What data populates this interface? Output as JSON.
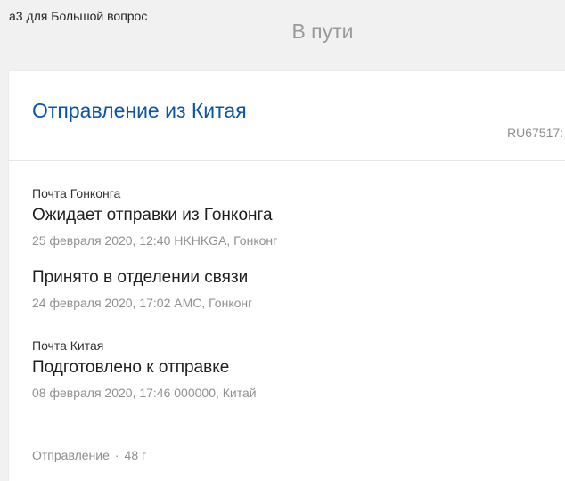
{
  "page": {
    "caption": "а3 для Большой вопрос",
    "status": "В пути"
  },
  "shipment": {
    "title": "Отправление из Китая",
    "tracking_number": "RU67517:",
    "events": [
      {
        "operator": "Почта Гонконга",
        "description": "Ожидает отправки из Гонконга",
        "meta": "25 февраля 2020, 12:40 HKHKGA, Гонконг"
      },
      {
        "operator": "",
        "description": "Принято в отделении связи",
        "meta": "24 февраля 2020, 17:02 AMC, Гонконг"
      },
      {
        "operator": "Почта Китая",
        "description": "Подготовлено к отправке",
        "meta": "08 февраля 2020, 17:46 000000, Китай"
      }
    ],
    "footer": {
      "type": "Отправление",
      "separator": "·",
      "weight": "48 г"
    }
  }
}
